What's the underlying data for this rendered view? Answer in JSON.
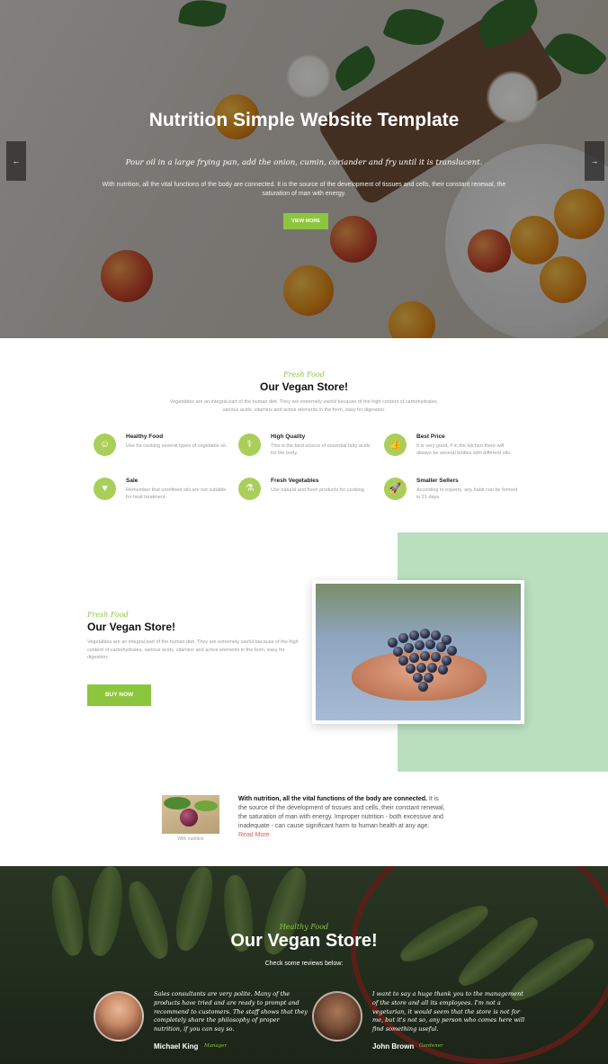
{
  "colors": {
    "accent": "#8cc63e",
    "icon_bg": "#a9cf5a",
    "panel": "#b9dfbf",
    "link": "#e25c5c"
  },
  "hero": {
    "title": "Nutrition Simple Website Template",
    "script_line": "Pour oil in a large frying pan, add the onion, cumin, coriander and fry until it is translucent.",
    "text": "With nutrition, all the vital functions of the body are connected. It is the source of the development of tissues and cells, their constant renewal, the saturation of man with energy.",
    "button": "VIEW MORE",
    "prev_icon": "←",
    "next_icon": "→"
  },
  "features_section": {
    "script": "Fresh Food",
    "title": "Our Vegan Store!",
    "intro": "Vegetables are an integral part of the human diet. They are extremely useful because of the high content of carbohydrates, various acids, vitamins and active elements in the form, easy for digestion.",
    "items": [
      {
        "icon": "smile-icon",
        "glyph": "☺",
        "title": "Healthy Food",
        "desc": "Use for cooking several types of vegetable oil."
      },
      {
        "icon": "stethoscope-icon",
        "glyph": "⚕",
        "title": "High Quality",
        "desc": "This is the best source of essential fatty acids for the body."
      },
      {
        "icon": "thumbs-up-icon",
        "glyph": "👍",
        "title": "Best Price",
        "desc": "It is very good, if in the kitchen there will always be several bottles with different oils."
      },
      {
        "icon": "heart-icon",
        "glyph": "♥",
        "title": "Sale",
        "desc": "Remember that unrefined oils are not suitable for heat treatment."
      },
      {
        "icon": "flask-icon",
        "glyph": "⚗",
        "title": "Fresh Vegetables",
        "desc": "Use natural and fresh products for cooking."
      },
      {
        "icon": "rocket-icon",
        "glyph": "🚀",
        "title": "Smaller Sellers",
        "desc": "According to experts, any habit can be formed in 21 days."
      }
    ]
  },
  "store": {
    "script": "Fresh Food",
    "title": "Our Vegan Store!",
    "desc": "Vegetables are an integral part of the human diet. They are extremely useful because of the high content of carbohydrates, various acids, vitamins and active elements in the form, easy for digestion.",
    "button": "BUY NOW"
  },
  "info": {
    "caption": "With nutrition",
    "bold": "With nutrition, all the vital functions of the body are connected.",
    "text": " It is the source of the development of tissues and cells, their constant renewal, the saturation of man with energy. Improper nutrition - both excessive and inadequate - can cause significant harm to human health at any age.",
    "read_more": "Read More"
  },
  "reviews": {
    "script": "Healthy Food",
    "title": "Our Vegan Store!",
    "subtitle": "Check some reviews below:",
    "items": [
      {
        "quote": "Sales consultants are very polite. Many of the products have tried and are ready to prompt and recommend to customers. The staff shows that they completely share the philosophy of proper nutrition, if you can say so.",
        "name": "Michael King",
        "role": "Manager"
      },
      {
        "quote": "I want to say a huge thank you to the management of the store and all its employees. I'm not a vegetarian, it would seem that the store is not for me, but it's not so, any person who comes here will find something useful.",
        "name": "John Brown",
        "role": "Gardener"
      }
    ]
  }
}
